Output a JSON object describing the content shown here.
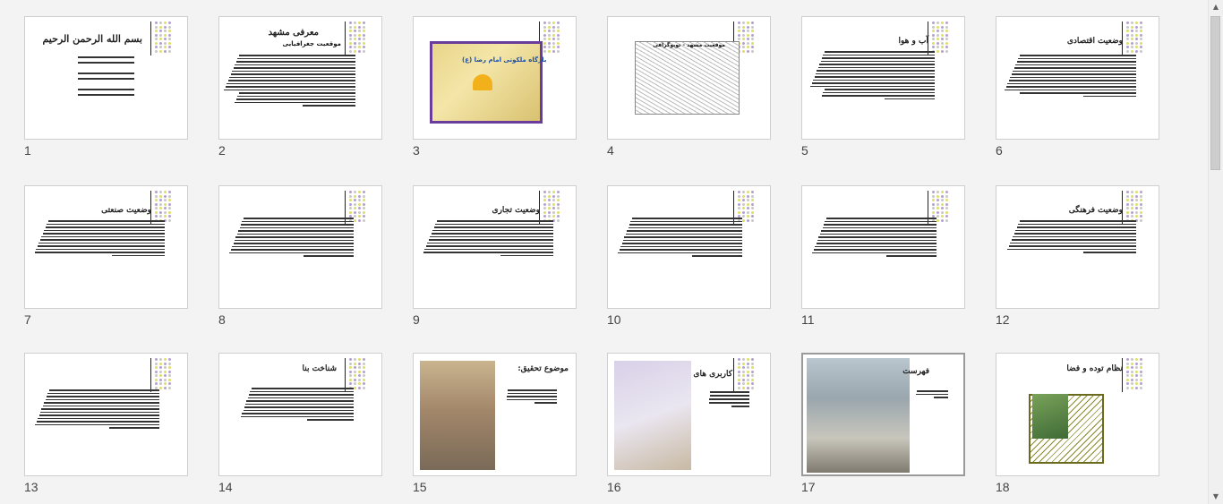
{
  "slides": [
    {
      "num": "1",
      "title": "بسم الله الرحمن الرحیم"
    },
    {
      "num": "2",
      "title": "معرفی مشهد",
      "subtitle": "موقعیت جغرافیایی"
    },
    {
      "num": "3",
      "title": "",
      "map_label": "بارگاه ملکوتی امام رضا (ع)"
    },
    {
      "num": "4",
      "title": "",
      "map_caption": "موقعیت مشهد - توپوگرافی"
    },
    {
      "num": "5",
      "title": "آب و هوا"
    },
    {
      "num": "6",
      "title": "وضعیت اقتصادی"
    },
    {
      "num": "7",
      "title": "وضعیت صنعتی"
    },
    {
      "num": "8",
      "title": ""
    },
    {
      "num": "9",
      "title": "وضعیت تجاری"
    },
    {
      "num": "10",
      "title": ""
    },
    {
      "num": "11",
      "title": ""
    },
    {
      "num": "12",
      "title": "وضعیت فرهنگی"
    },
    {
      "num": "13",
      "title": ""
    },
    {
      "num": "14",
      "title": "شناخت بنا"
    },
    {
      "num": "15",
      "title": "موضوع تحقیق:"
    },
    {
      "num": "16",
      "title": "کاربری های اطراف"
    },
    {
      "num": "17",
      "title": "فهرست"
    },
    {
      "num": "18",
      "title": "نظام توده و فضا"
    }
  ],
  "colors": {
    "accent_dot1": "#b59fcf",
    "accent_dot2": "#c8c8c8",
    "accent_dot3": "#dede6a",
    "selected_border": "#9a9a9a"
  },
  "scrollbar": {
    "up_icon": "▲",
    "down_icon": "▼"
  }
}
